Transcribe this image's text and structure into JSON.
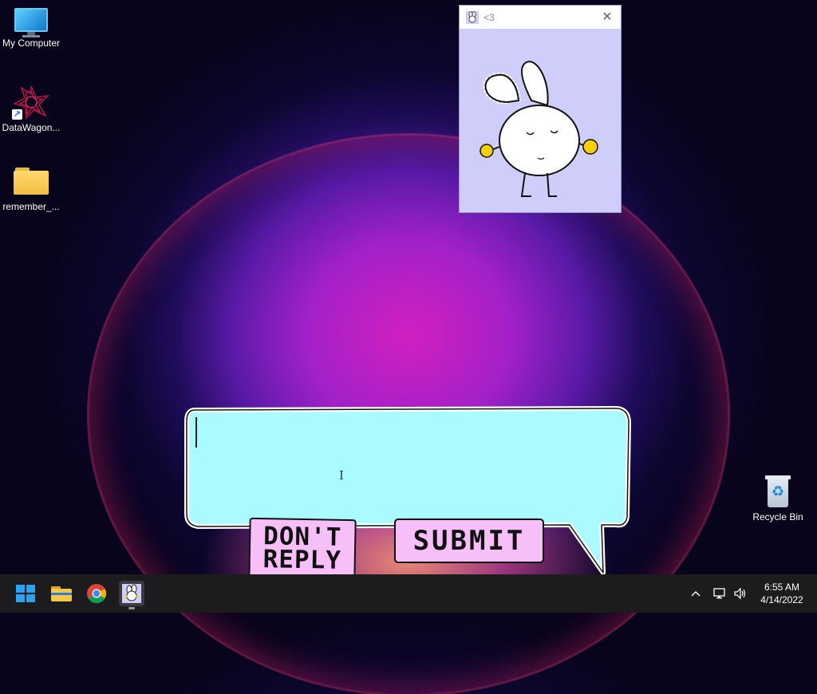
{
  "desktop": {
    "icons": [
      {
        "label": "My Computer",
        "icon": "monitor-icon"
      },
      {
        "label": "DataWagon...",
        "icon": "datawagon-shortcut-icon"
      },
      {
        "label": "remember_...",
        "icon": "folder-icon"
      }
    ],
    "recycle_bin": {
      "label": "Recycle Bin",
      "icon": "recycle-bin-icon"
    }
  },
  "bunny_window": {
    "title": "<3",
    "close_glyph": "✕",
    "background": "#cfcdfa"
  },
  "reply_dialog": {
    "input_value": "",
    "dont_reply_line1": "DON'T",
    "dont_reply_line2": "REPLY",
    "submit_label": "SUBMIT",
    "bubble_color": "#a9fbff",
    "button_color": "#f6bff7"
  },
  "taskbar": {
    "apps": [
      {
        "name": "Start",
        "icon": "windows-start-icon"
      },
      {
        "name": "File Explorer",
        "icon": "folder-icon"
      },
      {
        "name": "Google Chrome",
        "icon": "chrome-icon"
      },
      {
        "name": "Bunny app",
        "icon": "bunny-icon"
      }
    ],
    "tray": {
      "chevron": "^",
      "volume_glyph": "🔊"
    },
    "clock": {
      "time": "6:55 AM",
      "date": "4/14/2022"
    }
  }
}
